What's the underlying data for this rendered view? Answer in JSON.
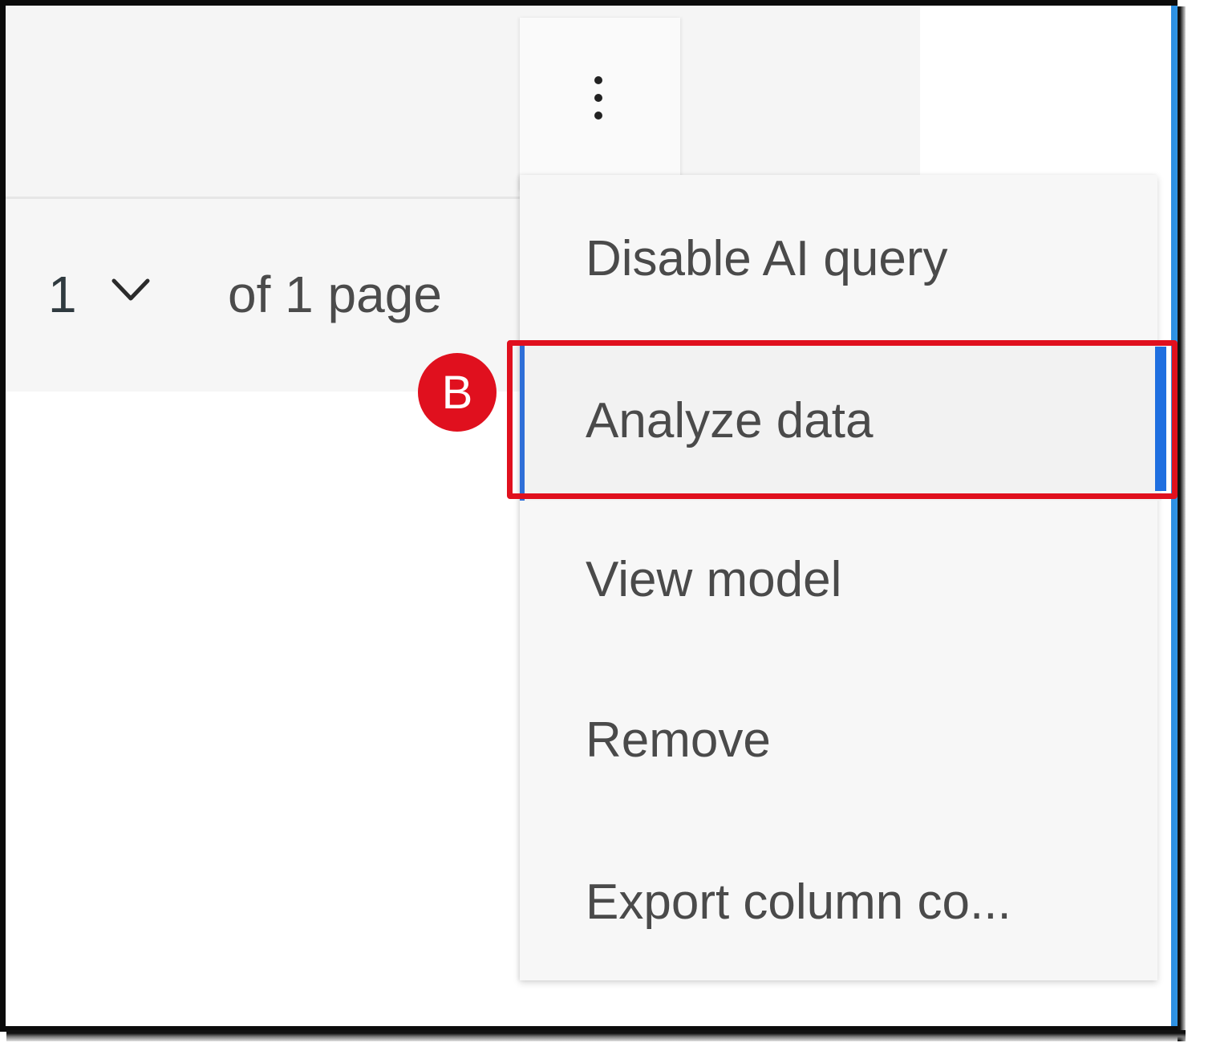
{
  "pagination": {
    "current_page": "1",
    "total_label": "of 1 page"
  },
  "overflow_menu": {
    "items": [
      {
        "label": "Disable AI query"
      },
      {
        "label": "Analyze data"
      },
      {
        "label": "View model"
      },
      {
        "label": "Remove"
      },
      {
        "label": "Export column co..."
      }
    ]
  },
  "annotation": {
    "badge_label": "B",
    "highlight_color": "#e0101e"
  },
  "colors": {
    "accent_blue": "#2f6fd8",
    "edge_blue": "#2f95e6"
  }
}
